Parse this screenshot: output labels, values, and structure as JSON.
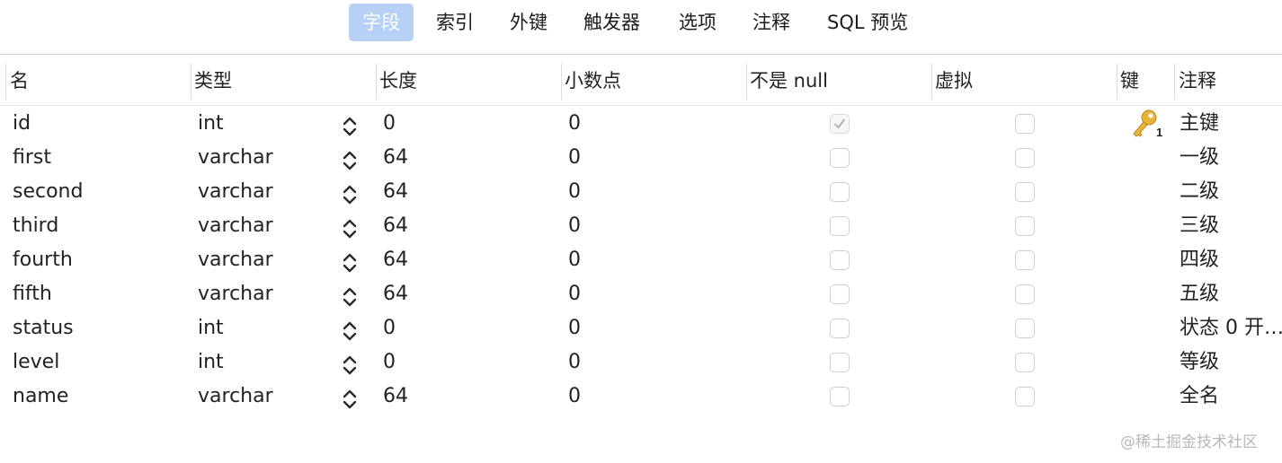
{
  "tabs": [
    "字段",
    "索引",
    "外键",
    "触发器",
    "选项",
    "注释",
    "SQL 预览"
  ],
  "active_tab": "字段",
  "columns": {
    "name": "名",
    "type": "类型",
    "length": "长度",
    "decimals": "小数点",
    "not_null": "不是 null",
    "virtual": "虚拟",
    "key": "键",
    "comment": "注释"
  },
  "rows": [
    {
      "name": "id",
      "type": "int",
      "length": "0",
      "decimals": "0",
      "not_null": true,
      "virtual": false,
      "key": "1",
      "comment": "主键"
    },
    {
      "name": "first",
      "type": "varchar",
      "length": "64",
      "decimals": "0",
      "not_null": false,
      "virtual": false,
      "key": "",
      "comment": "一级"
    },
    {
      "name": "second",
      "type": "varchar",
      "length": "64",
      "decimals": "0",
      "not_null": false,
      "virtual": false,
      "key": "",
      "comment": "二级"
    },
    {
      "name": "third",
      "type": "varchar",
      "length": "64",
      "decimals": "0",
      "not_null": false,
      "virtual": false,
      "key": "",
      "comment": "三级"
    },
    {
      "name": "fourth",
      "type": "varchar",
      "length": "64",
      "decimals": "0",
      "not_null": false,
      "virtual": false,
      "key": "",
      "comment": "四级"
    },
    {
      "name": "fifth",
      "type": "varchar",
      "length": "64",
      "decimals": "0",
      "not_null": false,
      "virtual": false,
      "key": "",
      "comment": "五级"
    },
    {
      "name": "status",
      "type": "int",
      "length": "0",
      "decimals": "0",
      "not_null": false,
      "virtual": false,
      "key": "",
      "comment": "状态 0 开…"
    },
    {
      "name": "level",
      "type": "int",
      "length": "0",
      "decimals": "0",
      "not_null": false,
      "virtual": false,
      "key": "",
      "comment": "等级"
    },
    {
      "name": "name",
      "type": "varchar",
      "length": "64",
      "decimals": "0",
      "not_null": false,
      "virtual": false,
      "key": "",
      "comment": "全名"
    }
  ],
  "icons": {
    "primary_key": "key-icon",
    "type_stepper": "chevron-up-down-icon",
    "checkbox": "checkbox-icon"
  },
  "colors": {
    "active_tab_bg": "#b7d1f6",
    "key_icon": "#e9b43c"
  },
  "watermark": "@稀土掘金技术社区"
}
